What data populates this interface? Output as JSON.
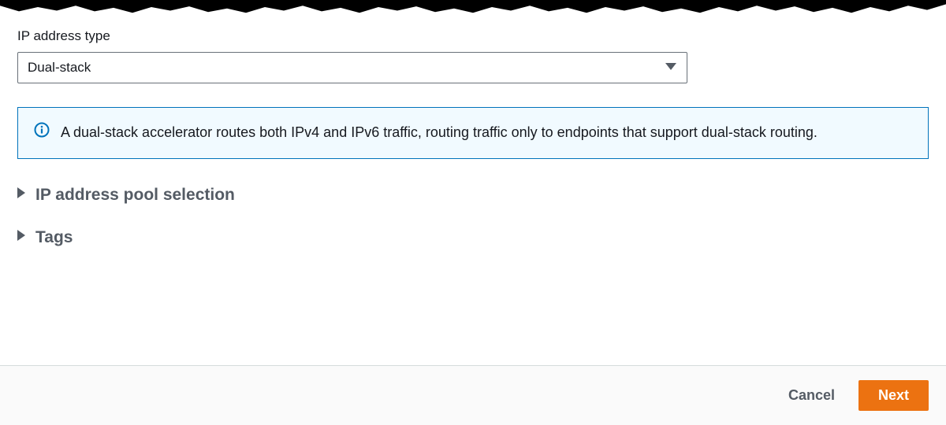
{
  "ip_type": {
    "label": "IP address type",
    "selected": "Dual-stack"
  },
  "info": {
    "text": "A dual-stack accelerator routes both IPv4 and IPv6 traffic, routing traffic only to endpoints that support dual-stack routing."
  },
  "expanders": {
    "pool": "IP address pool selection",
    "tags": "Tags"
  },
  "footer": {
    "cancel": "Cancel",
    "next": "Next"
  },
  "colors": {
    "accent": "#ec7211",
    "info_border": "#0073bb",
    "gray_text": "#545b64"
  }
}
